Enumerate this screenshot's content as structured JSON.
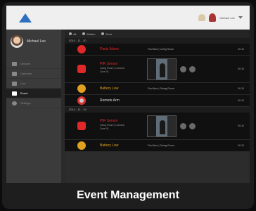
{
  "header": {
    "user_label": "Michael Lee"
  },
  "sidebar": {
    "profile_name": "Michael Lee",
    "items": [
      {
        "label": "Devices"
      },
      {
        "label": "Cameras"
      },
      {
        "label": "Live"
      },
      {
        "label": "Event"
      },
      {
        "label": "Settings"
      }
    ]
  },
  "toolbar": {
    "items": [
      {
        "label": "All"
      },
      {
        "label": "Motion"
      },
      {
        "label": "Door"
      }
    ]
  },
  "event_groups": [
    {
      "date": "2014 - 11 - 20",
      "events": [
        {
          "title": "Panic Alarm",
          "info": "First floor | Living Room",
          "time": "00:10",
          "color": "#e02828"
        },
        {
          "title": "PIR Sensor",
          "sub1": "Living Room | Camera",
          "sub2": "Zone 01",
          "time": "00:10",
          "color": "#e02828"
        },
        {
          "title": "Battery Low",
          "info": "First floor | Dining Room",
          "time": "00:10",
          "color": "#e0a020"
        },
        {
          "title": "Remote Arm",
          "time": "00:10",
          "color": "#dddddd"
        }
      ]
    },
    {
      "date": "2014 - 11 - 19",
      "events": [
        {
          "title": "PIR Sensor",
          "sub1": "Living Room | Camera",
          "sub2": "Zone 01",
          "time": "00:10",
          "color": "#e02828"
        },
        {
          "title": "Battery Low",
          "info": "First floor | Dining Room",
          "time": "00:10",
          "color": "#e0a020"
        }
      ]
    }
  ],
  "caption": "Event Management"
}
